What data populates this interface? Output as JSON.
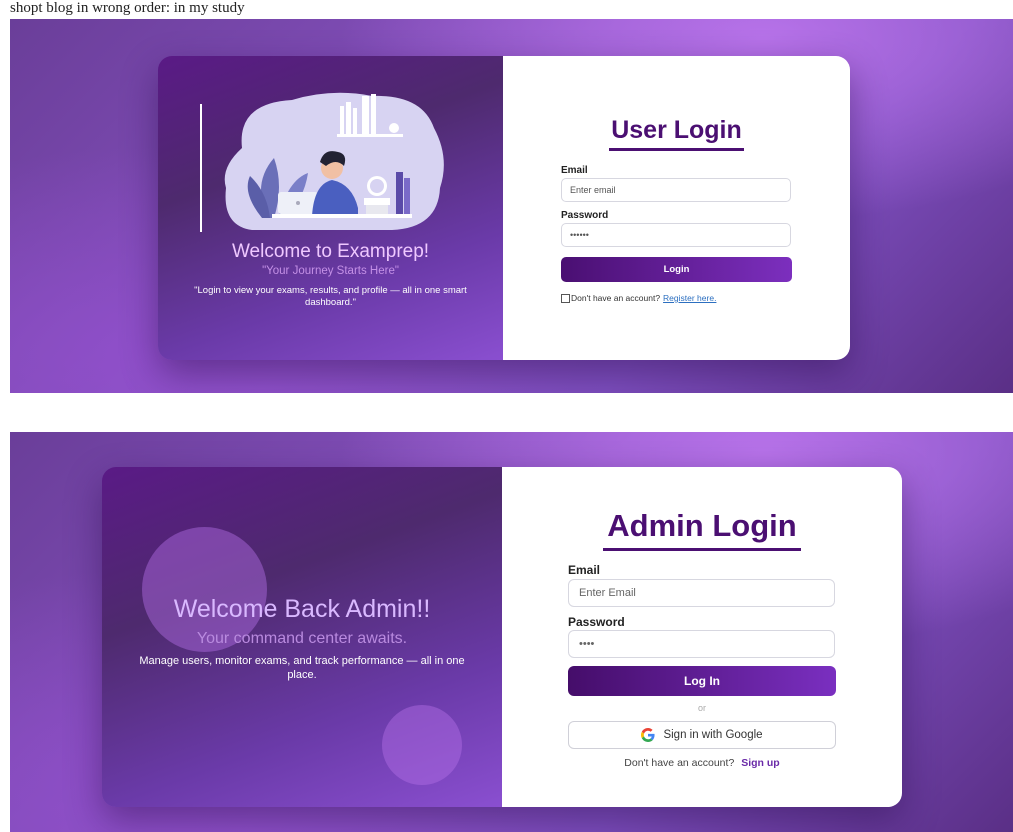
{
  "caption": "shopt blog in wrong order: in my study",
  "user_login": {
    "welcome": "Welcome to Examprep!",
    "tagline": "\"Your Journey Starts Here\"",
    "description": "\"Login to view your exams, results, and profile — all in one smart dashboard.\"",
    "title": "User Login",
    "email_label": "Email",
    "email_placeholder": "Enter email",
    "password_label": "Password",
    "password_value": "••••••",
    "login_button": "Login",
    "register_text": "Don't have an account?",
    "register_link": "Register here."
  },
  "admin_login": {
    "welcome": "Welcome Back Admin!!",
    "tagline": "Your command center awaits.",
    "description": "Manage users, monitor exams, and track performance — all in one place.",
    "title": "Admin Login",
    "email_label": "Email",
    "email_placeholder": "Enter Email",
    "password_label": "Password",
    "password_value": "••••",
    "login_button": "Log In",
    "or_text": "or",
    "google_button": "Sign in with Google",
    "signup_text": "Don't have an account?",
    "signup_link": "Sign up"
  },
  "colors": {
    "accent": "#4b0f72",
    "button_start": "#4a0f72",
    "button_end": "#7c2fbe",
    "link": "#2c6fc0"
  },
  "icons": [
    "study-illustration",
    "google-g-icon",
    "checkbox-icon"
  ]
}
